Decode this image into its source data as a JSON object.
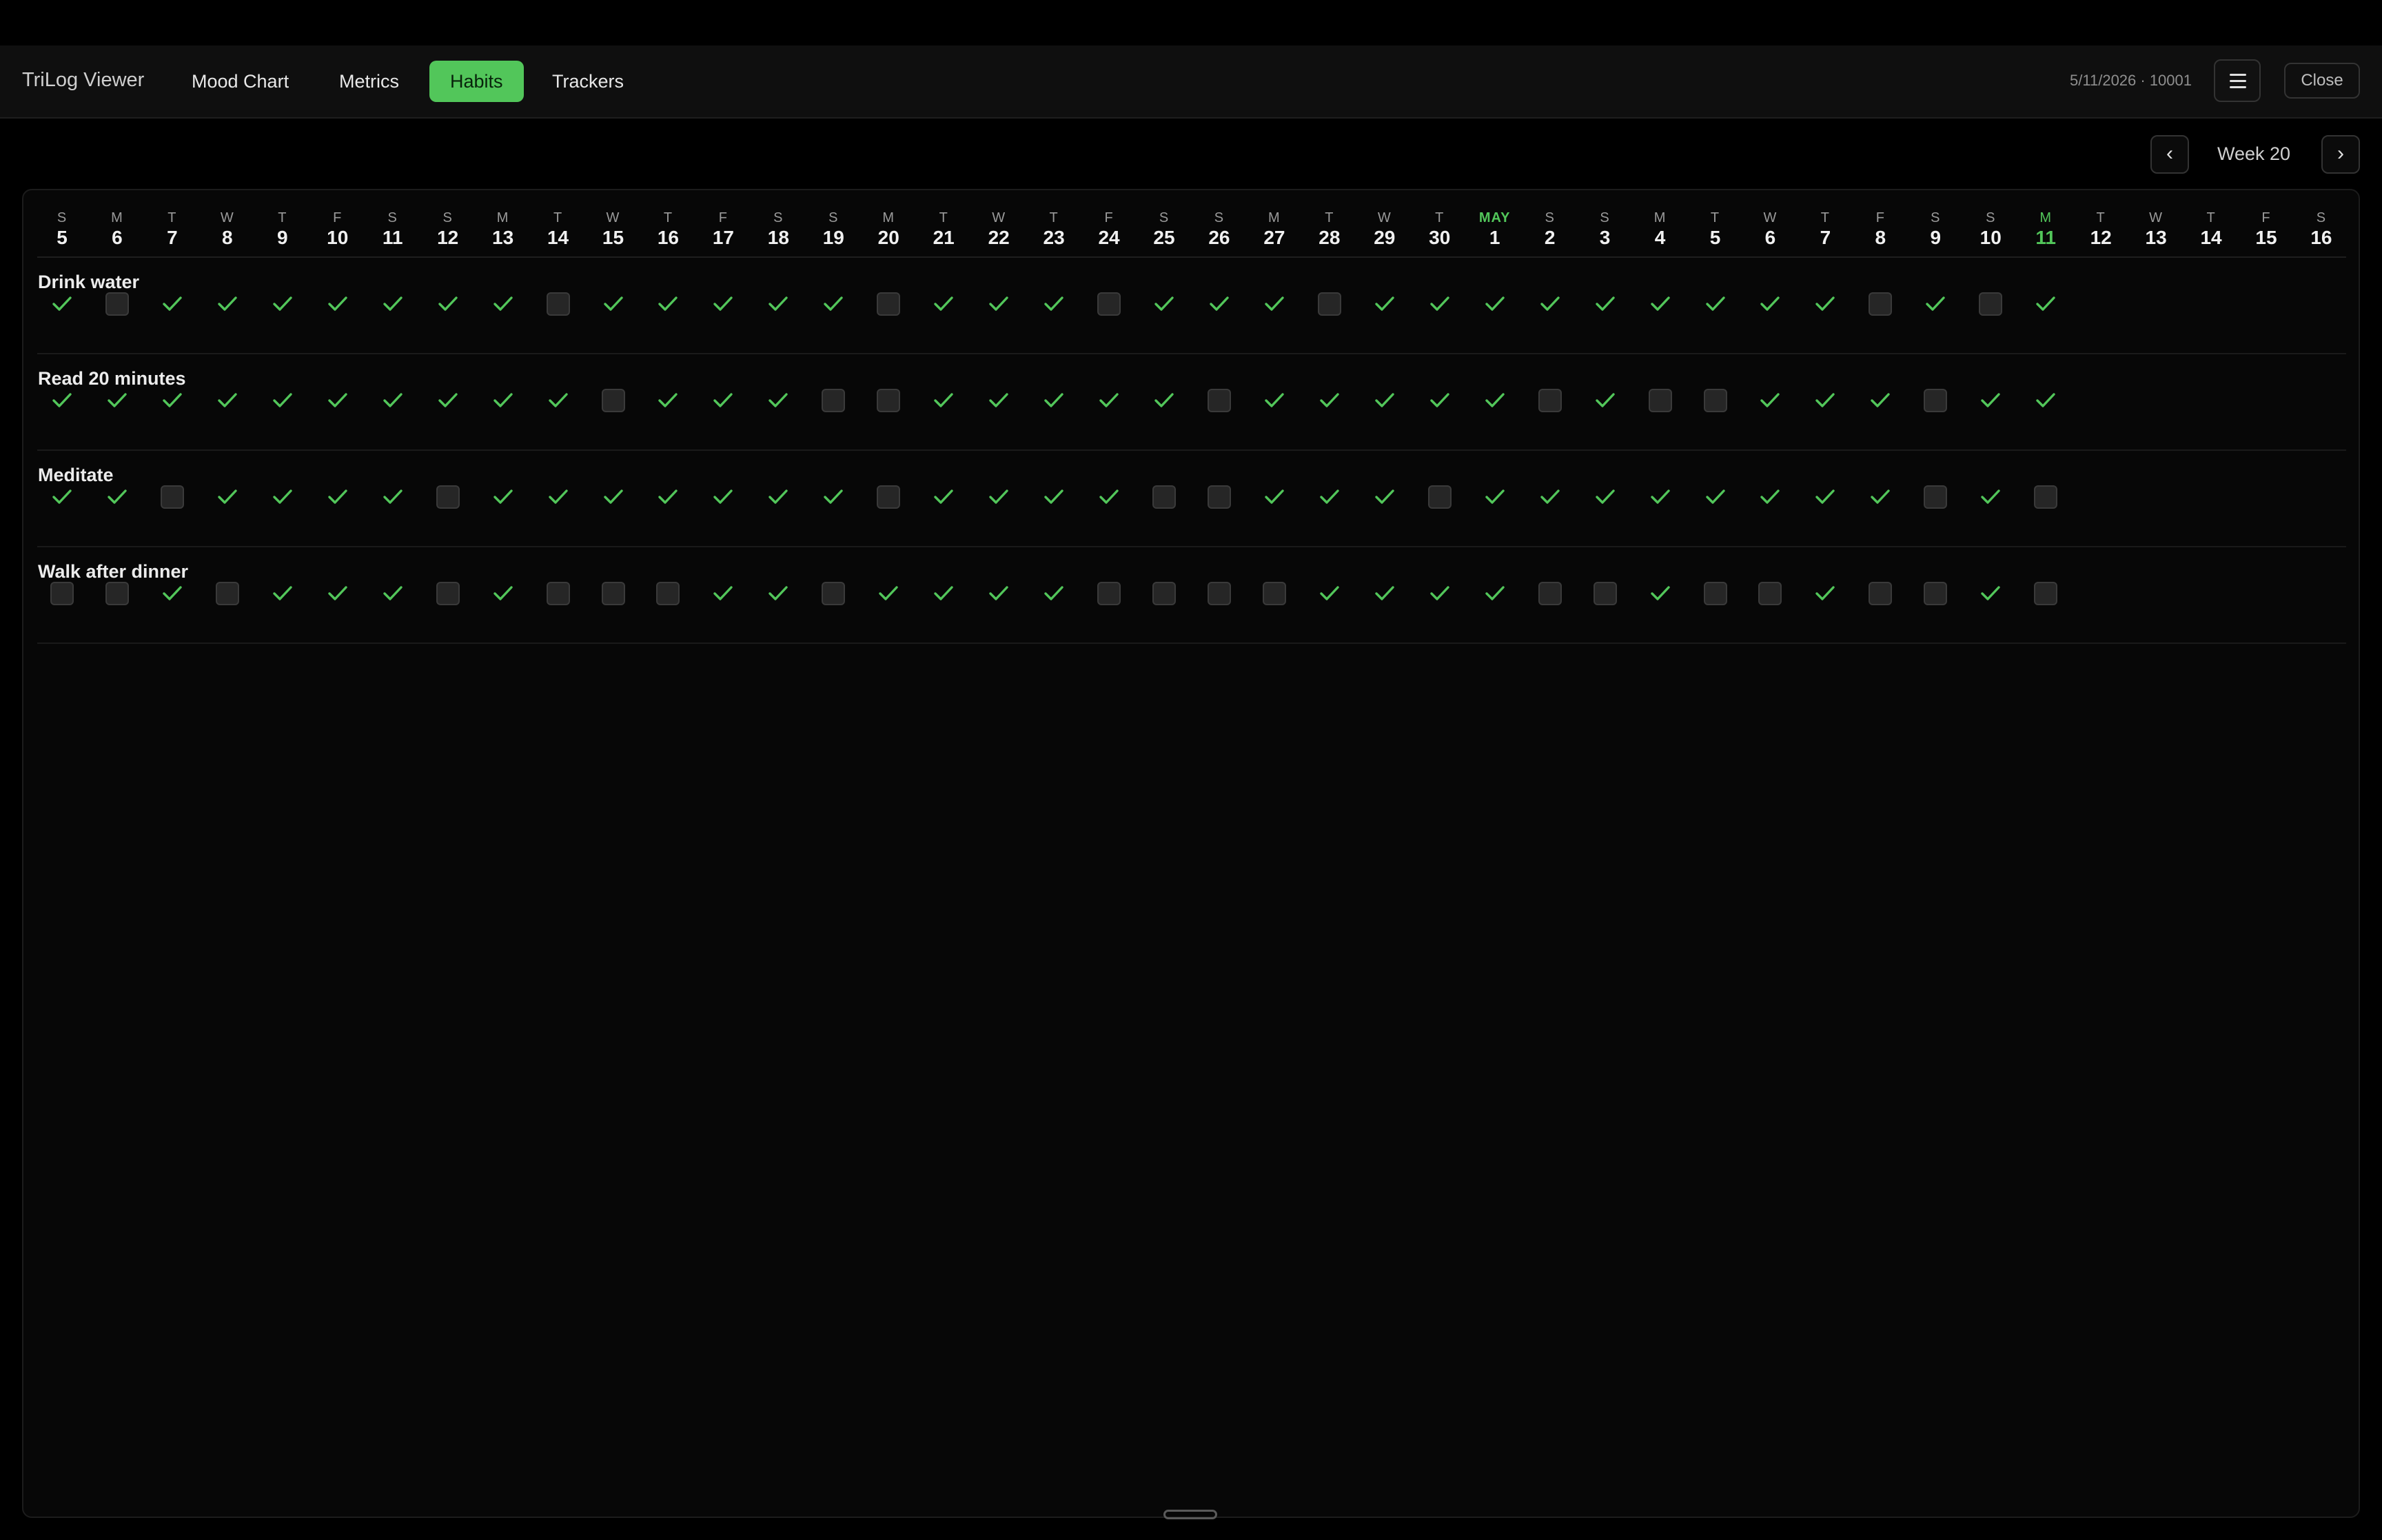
{
  "app": {
    "title": "TriLog Viewer"
  },
  "nav": {
    "tabs": [
      {
        "label": "Mood Chart",
        "active": false
      },
      {
        "label": "Metrics",
        "active": false
      },
      {
        "label": "Habits",
        "active": true
      },
      {
        "label": "Trackers",
        "active": false
      }
    ]
  },
  "header": {
    "meta": "5/11/2026 · 10001",
    "menu_icon": "hamburger-icon",
    "close_label": "Close"
  },
  "week_nav": {
    "prev": "‹",
    "label": "Week 20",
    "next": "›"
  },
  "colors": {
    "accent": "#52c65a",
    "background": "#000000",
    "panel": "#070707"
  },
  "days": [
    {
      "dow": "S",
      "num": "5"
    },
    {
      "dow": "M",
      "num": "6"
    },
    {
      "dow": "T",
      "num": "7"
    },
    {
      "dow": "W",
      "num": "8"
    },
    {
      "dow": "T",
      "num": "9"
    },
    {
      "dow": "F",
      "num": "10"
    },
    {
      "dow": "S",
      "num": "11"
    },
    {
      "dow": "S",
      "num": "12"
    },
    {
      "dow": "M",
      "num": "13"
    },
    {
      "dow": "T",
      "num": "14"
    },
    {
      "dow": "W",
      "num": "15"
    },
    {
      "dow": "T",
      "num": "16"
    },
    {
      "dow": "F",
      "num": "17"
    },
    {
      "dow": "S",
      "num": "18"
    },
    {
      "dow": "S",
      "num": "19"
    },
    {
      "dow": "M",
      "num": "20"
    },
    {
      "dow": "T",
      "num": "21"
    },
    {
      "dow": "W",
      "num": "22"
    },
    {
      "dow": "T",
      "num": "23"
    },
    {
      "dow": "F",
      "num": "24"
    },
    {
      "dow": "S",
      "num": "25"
    },
    {
      "dow": "S",
      "num": "26"
    },
    {
      "dow": "M",
      "num": "27"
    },
    {
      "dow": "T",
      "num": "28"
    },
    {
      "dow": "W",
      "num": "29"
    },
    {
      "dow": "T",
      "num": "30"
    },
    {
      "dow": "MAY",
      "num": "1",
      "month": true
    },
    {
      "dow": "S",
      "num": "2"
    },
    {
      "dow": "S",
      "num": "3"
    },
    {
      "dow": "M",
      "num": "4"
    },
    {
      "dow": "T",
      "num": "5"
    },
    {
      "dow": "W",
      "num": "6"
    },
    {
      "dow": "T",
      "num": "7"
    },
    {
      "dow": "F",
      "num": "8"
    },
    {
      "dow": "S",
      "num": "9"
    },
    {
      "dow": "S",
      "num": "10"
    },
    {
      "dow": "M",
      "num": "11",
      "today": true
    },
    {
      "dow": "T",
      "num": "12"
    },
    {
      "dow": "W",
      "num": "13"
    },
    {
      "dow": "T",
      "num": "14"
    },
    {
      "dow": "F",
      "num": "15"
    },
    {
      "dow": "S",
      "num": "16"
    }
  ],
  "habits": [
    {
      "name": "Drink water",
      "marks": [
        1,
        0,
        1,
        1,
        1,
        1,
        1,
        1,
        1,
        0,
        1,
        1,
        1,
        1,
        1,
        0,
        1,
        1,
        1,
        0,
        1,
        1,
        1,
        0,
        1,
        1,
        1,
        1,
        1,
        1,
        1,
        1,
        1,
        0,
        1,
        0,
        1
      ]
    },
    {
      "name": "Read 20 minutes",
      "marks": [
        1,
        1,
        1,
        1,
        1,
        1,
        1,
        1,
        1,
        1,
        0,
        1,
        1,
        1,
        0,
        0,
        1,
        1,
        1,
        1,
        1,
        0,
        1,
        1,
        1,
        1,
        1,
        0,
        1,
        0,
        0,
        1,
        1,
        1,
        0,
        1,
        1
      ]
    },
    {
      "name": "Meditate",
      "marks": [
        1,
        1,
        0,
        1,
        1,
        1,
        1,
        0,
        1,
        1,
        1,
        1,
        1,
        1,
        1,
        0,
        1,
        1,
        1,
        1,
        0,
        0,
        1,
        1,
        1,
        0,
        1,
        1,
        1,
        1,
        1,
        1,
        1,
        1,
        0,
        1,
        0
      ]
    },
    {
      "name": "Walk after dinner",
      "marks": [
        0,
        0,
        1,
        0,
        1,
        1,
        1,
        0,
        1,
        0,
        0,
        0,
        1,
        1,
        0,
        1,
        1,
        1,
        1,
        0,
        0,
        0,
        0,
        1,
        1,
        1,
        1,
        0,
        0,
        1,
        0,
        0,
        1,
        0,
        0,
        1,
        0
      ]
    }
  ]
}
